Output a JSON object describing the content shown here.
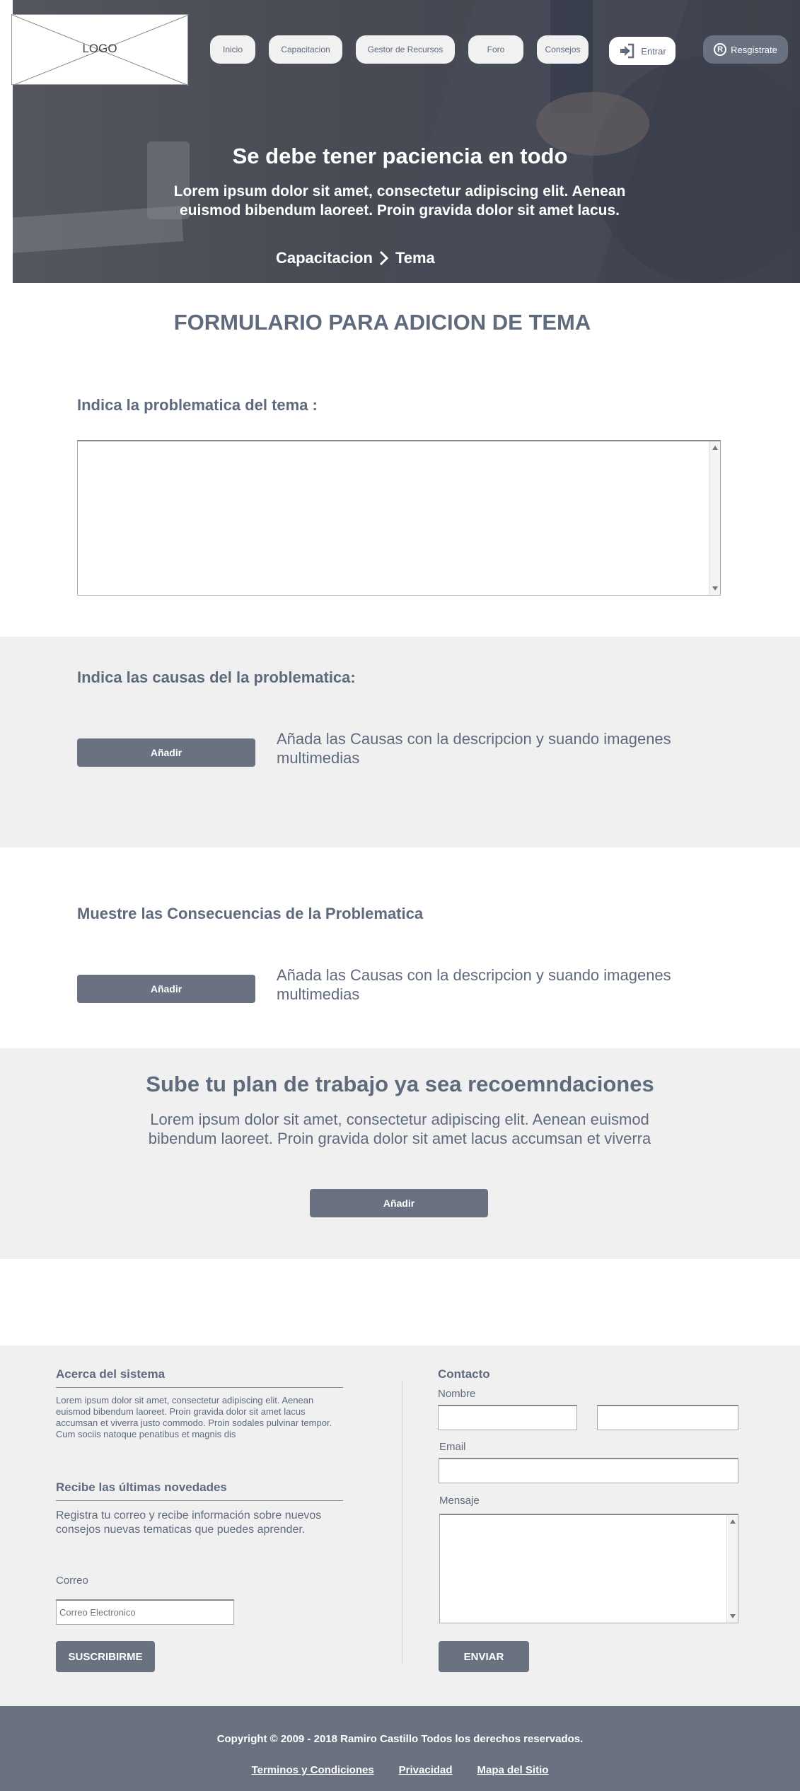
{
  "header": {
    "logo": "LOGO",
    "nav": [
      "Inicio",
      "Capacitacion",
      "Gestor de Recursos",
      "Foro",
      "Consejos"
    ],
    "login_label": "Entrar",
    "register_label": "Resgistrate"
  },
  "hero": {
    "title": "Se debe tener paciencia en todo",
    "subtitle": "Lorem ipsum dolor sit amet, consectetur adipiscing elit. Aenean euismod bibendum laoreet. Proin gravida dolor sit amet lacus.",
    "breadcrumb": [
      "Capacitacion",
      "Tema"
    ]
  },
  "form": {
    "title": "FORMULARIO PARA ADICION DE TEMA",
    "problem_label": "Indica  la problematica del tema :",
    "causes_label": "Indica las causas del la problematica:",
    "causes_button": "Añadir",
    "causes_desc": "Añada las Causas con la descripcion y suando imagenes multimedias",
    "consequences_label": "Muestre las Consecuencias de la Problematica",
    "consequences_button": "Añadir",
    "consequences_desc": "Añada las Causas con la descripcion y suando imagenes multimedias"
  },
  "plan": {
    "title": "Sube tu plan de trabajo ya sea recoemndaciones",
    "subtitle": "Lorem ipsum dolor sit amet, consectetur adipiscing elit. Aenean euismod bibendum laoreet. Proin gravida dolor sit amet lacus accumsan et viverra",
    "button": "Añadir"
  },
  "footer": {
    "about_title": "Acerca del sistema",
    "about_text": "Lorem ipsum dolor sit amet, consectetur adipiscing elit. Aenean euismod bibendum laoreet. Proin gravida dolor sit amet lacus accumsan et viverra justo commodo. Proin sodales pulvinar tempor. Cum sociis natoque penatibus et magnis dis",
    "news_title": "Recibe las últimas novedades",
    "news_text": "Registra tu correo y recibe información sobre nuevos consejos nuevas tematicas que puedes aprender.",
    "mail_label": "Correo",
    "mail_placeholder": "Correo Electronico",
    "subscribe_button": "SUSCRIBIRME",
    "contact_title": "Contacto",
    "name_label": "Nombre",
    "email_label": "Email",
    "message_label": "Mensaje",
    "send_button": "ENVIAR",
    "copyright": "Copyright © 2009 - 2018 Ramiro Castillo Todos los derechos reservados.",
    "links": [
      "Terminos y  Condiciones",
      "Privacidad",
      "Mapa del Sitio"
    ]
  }
}
